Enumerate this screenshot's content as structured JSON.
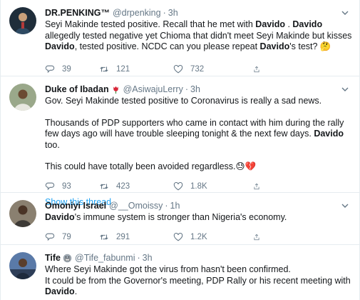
{
  "tweets": [
    {
      "name": "DR.PENKING™",
      "handle": "@drpenking",
      "time": "3h",
      "text": "Seyi Makinde tested positive. Recall that he met with **Davido** . **Davido** allegedly tested negative yet Chioma that didn't meet Seyi Makinde but kisses **Davido**, tested positive. NCDC can you please repeat **Davido**'s test? 🤔",
      "replies": "39",
      "retweets": "121",
      "likes": "732",
      "avatar_color": "#1f2d3a"
    },
    {
      "name": "Duke of Ibadan",
      "name_emoji": "red-tulip",
      "handle": "@AsiwajuLerry",
      "time": "3h",
      "paragraphs": [
        "Gov. Seyi Makinde tested positive to Coronavirus is really a sad news.",
        "Thousands of PDP supporters who came in contact with him during the rally few days ago will have trouble sleeping tonight & the next few days. **Davido** too.",
        "This could have totally been avoided regardless.😓💔"
      ],
      "replies": "93",
      "retweets": "423",
      "likes": "1.8K",
      "show_thread": "Show this thread",
      "avatar_color": "#7f8a6a"
    },
    {
      "name": "Omoniyi Israel",
      "handle": "@__Omoissy",
      "time": "1h",
      "text": "**Davido**'s immune system is stronger than Nigeria's economy.",
      "replies": "79",
      "retweets": "291",
      "likes": "1.2K",
      "avatar_color": "#5a4a3e"
    },
    {
      "name": "Tife",
      "name_emoji": "grimacing-face",
      "handle": "@Tife_fabunmi",
      "time": "3h",
      "paragraphs": [
        "Where Seyi Makinde got the virus from hasn't been confirmed.\nIt could be from the Governor's meeting, PDP Rally or his recent meeting with **Davido**."
      ],
      "avatar_color": "#4a6a9a"
    }
  ],
  "colors": {
    "text": "#14171a",
    "muted": "#657786",
    "link": "#1da1f2",
    "divider": "#e6ecf0"
  }
}
